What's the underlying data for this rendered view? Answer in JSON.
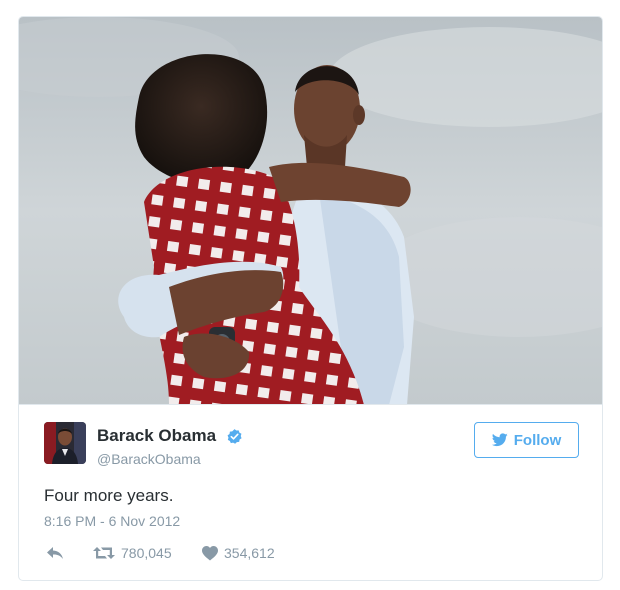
{
  "tweet": {
    "author": {
      "display_name": "Barack Obama",
      "handle": "@BarackObama",
      "verified": true
    },
    "follow_label": "Follow",
    "text": "Four more years.",
    "timestamp": "8:16 PM - 6 Nov 2012",
    "retweets": "780,045",
    "likes": "354,612"
  },
  "icons": {
    "verified": "verified-badge-icon",
    "follow": "twitter-bird-icon",
    "reply": "reply-icon",
    "retweet": "retweet-icon",
    "like": "heart-icon"
  },
  "colors": {
    "accent": "#55acee",
    "text": "#292f33",
    "muted": "#8899a6",
    "border": "#e1e8ed"
  }
}
